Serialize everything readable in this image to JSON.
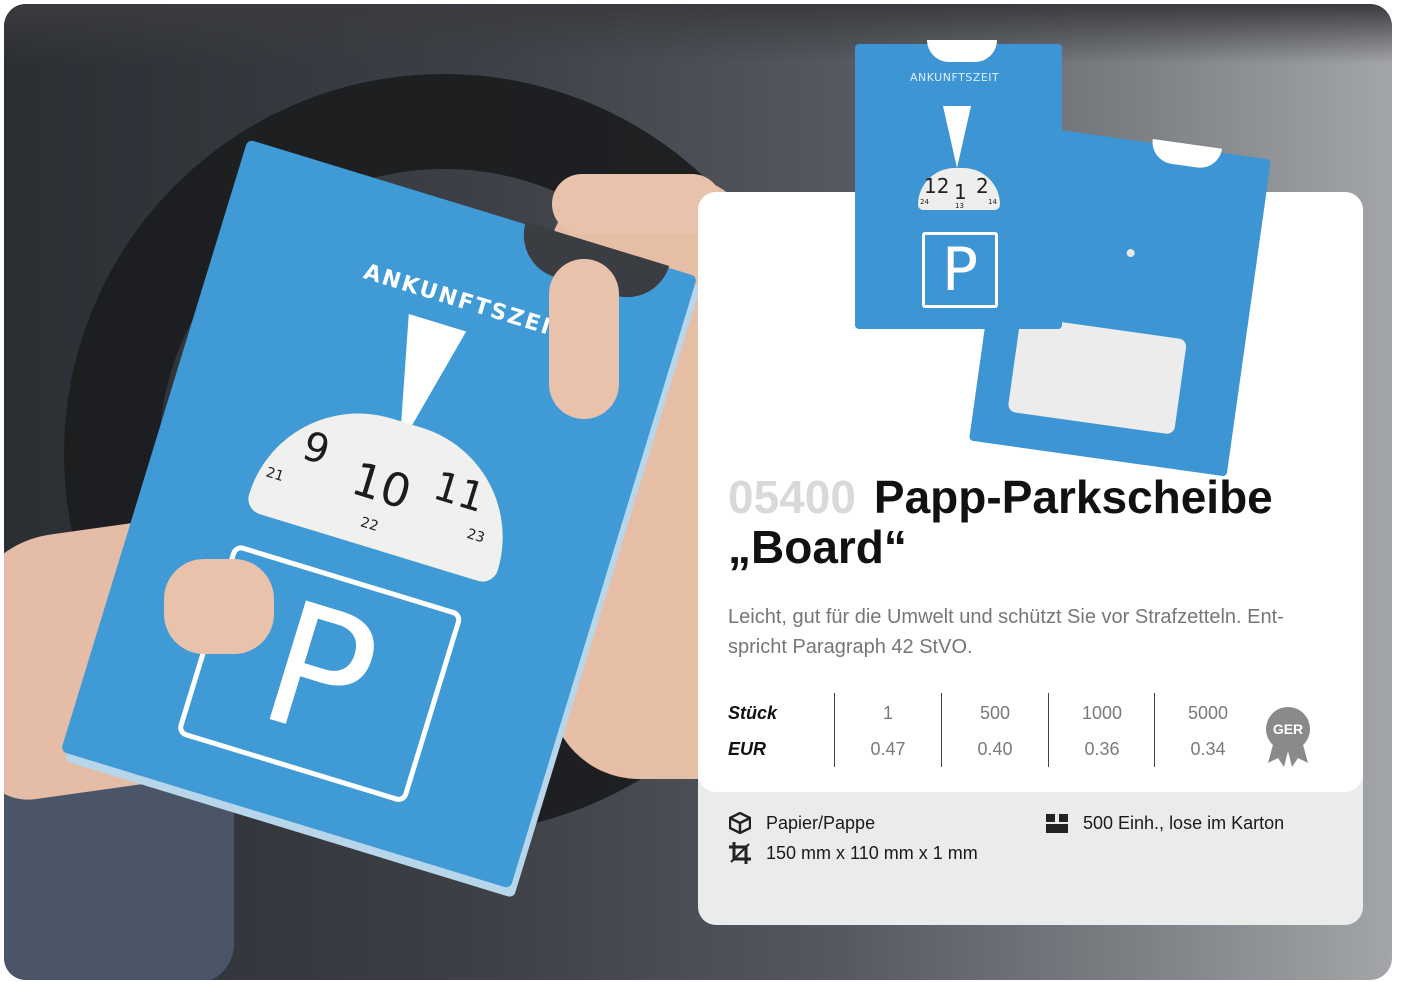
{
  "background_photo": {
    "disc_label": "ANKUNFTSZEIT",
    "dial_numbers": [
      "9",
      "10",
      "11"
    ],
    "dial_small_numbers": [
      "21",
      "22",
      "23"
    ],
    "sign": "P"
  },
  "product_image": {
    "disc_label": "ANKUNFTSZEIT",
    "dial_numbers": [
      "12",
      "1",
      "2"
    ],
    "dial_small_numbers": [
      "24",
      "13",
      "14"
    ],
    "sign": "P"
  },
  "product": {
    "number": "05400",
    "title": "Papp-Parkscheibe „Board“",
    "description": "Leicht, gut für die Umwelt und schützt Sie vor Strafzetteln. Ent­spricht Paragraph 42 StVO."
  },
  "prices": {
    "quantity_label": "Stück",
    "currency_label": "EUR",
    "tiers": [
      {
        "qty": "1",
        "price": "0.47"
      },
      {
        "qty": "500",
        "price": "0.40"
      },
      {
        "qty": "1000",
        "price": "0.36"
      },
      {
        "qty": "5000",
        "price": "0.34"
      }
    ],
    "origin_badge": "GER"
  },
  "attributes": {
    "material": "Papier/Pappe",
    "dimensions": "150 mm x 110 mm x 1 mm",
    "packaging": "500 Einh., lose im Karton"
  },
  "colors": {
    "disc_blue": "#3d95d3",
    "number_gray": "#d9d9d9",
    "card_bottom": "#eaebeb"
  },
  "icons": {
    "material": "box-icon",
    "dimensions": "crop-icon",
    "packaging": "carton-icon",
    "badge": "rosette-icon"
  }
}
